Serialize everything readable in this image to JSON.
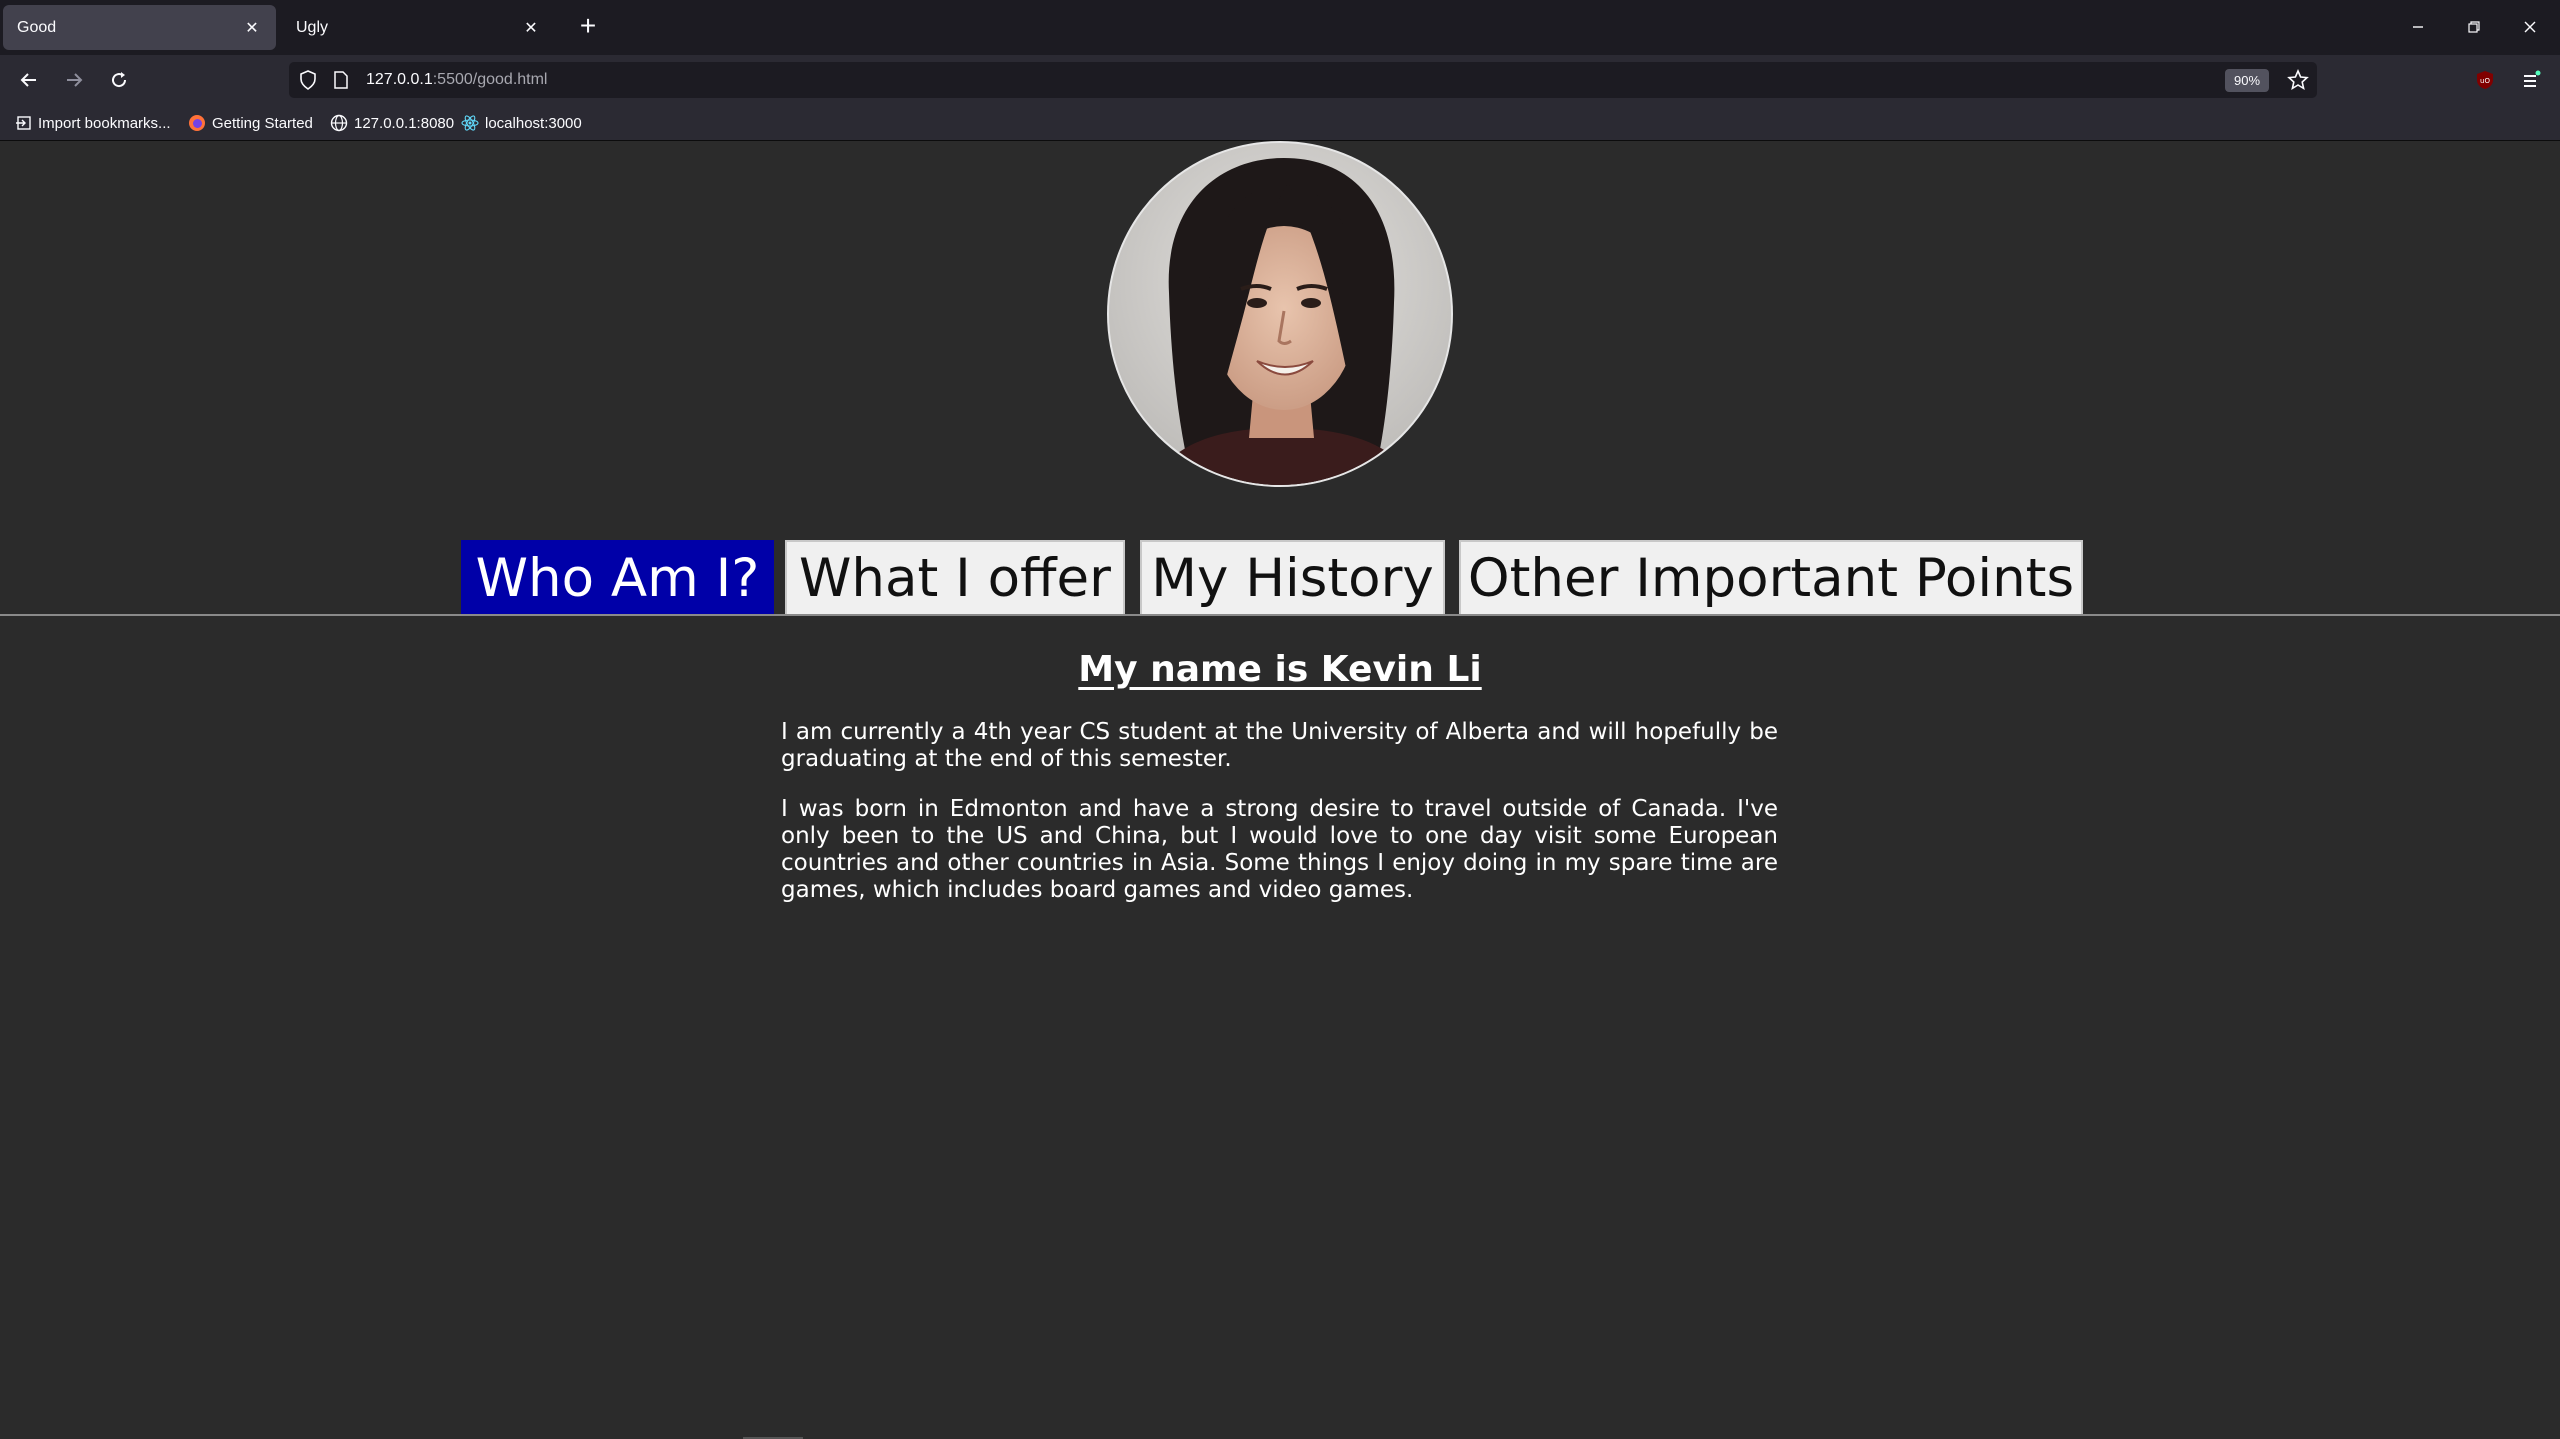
{
  "browser": {
    "tabs": [
      {
        "label": "Good",
        "active": true
      },
      {
        "label": "Ugly",
        "active": false
      }
    ],
    "new_tab_glyph": "+",
    "window_controls": {
      "minimize": "–",
      "restore": "⧉",
      "close": "✕"
    },
    "url": {
      "host": "127.0.0.1",
      "rest": ":5500/good.html"
    },
    "zoom": "90%",
    "bookmarks": [
      {
        "label": "Import bookmarks...",
        "icon": "import-icon"
      },
      {
        "label": "Getting Started",
        "icon": "firefox-icon"
      },
      {
        "label": "127.0.0.1:8080",
        "icon": "globe-icon"
      },
      {
        "label": "localhost:3000",
        "icon": "react-icon"
      }
    ]
  },
  "page": {
    "tabs": [
      {
        "label": "Who Am I?",
        "selected": true
      },
      {
        "label": "What I offer",
        "selected": false
      },
      {
        "label": "My History",
        "selected": false
      },
      {
        "label": "Other Important Points",
        "selected": false
      }
    ],
    "heading": "My name is Kevin Li",
    "paragraphs": [
      "I am currently a 4th year CS student at the University of Alberta and will hopefully be graduating at the end of this semester.",
      "I was born in Edmonton and have a strong desire to travel outside of Canada. I've only been to the US and China, but I would love to one day visit some European countries and other countries in Asia. Some things I enjoy doing in my spare time are games, which includes board games and video games."
    ]
  },
  "colors": {
    "page_bg": "#2b2b2b",
    "selected_tab_bg": "#0000a8",
    "tab_bg": "#f0f0f0",
    "text": "#ffffff"
  }
}
